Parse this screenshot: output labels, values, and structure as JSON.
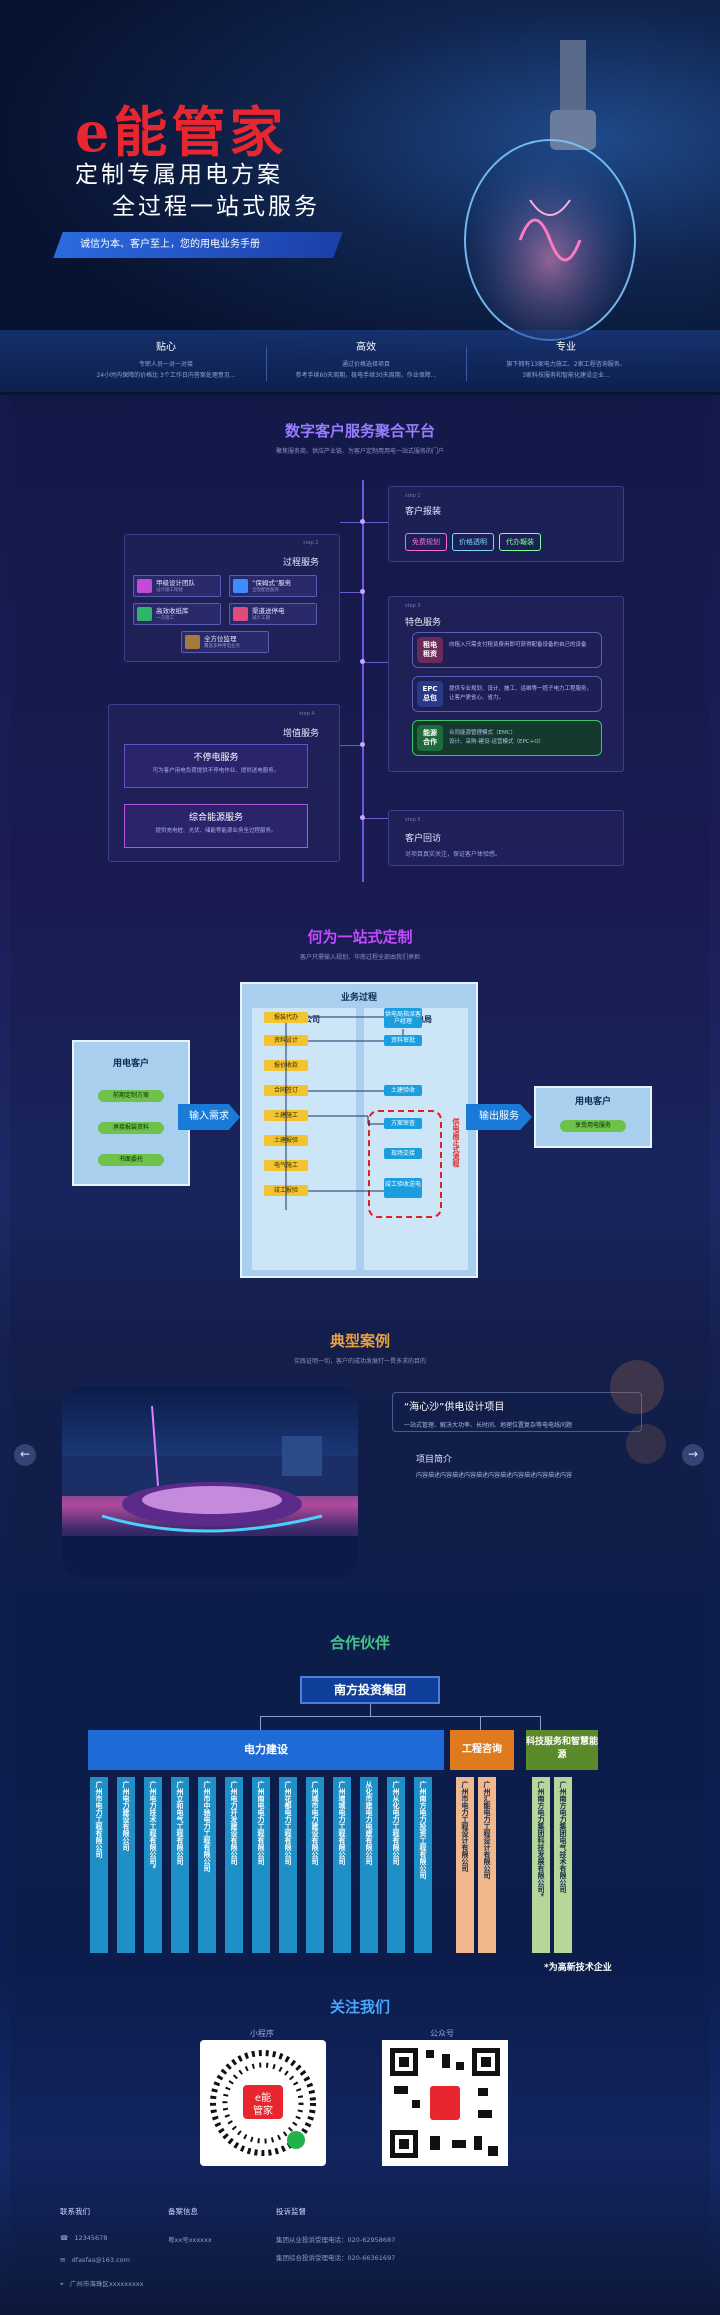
{
  "hero": {
    "logo": "e能管家",
    "line1": "定制专属用电方案",
    "line2": "全过程一站式服务",
    "bar": "诚信为本、客户至上，您的用电业务手册",
    "features": [
      {
        "title": "贴心",
        "desc1": "专职人员一对一对接",
        "desc2": "24小时内保障的价格比 3个工作日内答案处理意见..."
      },
      {
        "title": "高效",
        "desc1": "通过价格选择项目",
        "desc2": "参考手续60天周期，极电手续30天周期，作业保障..."
      },
      {
        "title": "专业",
        "desc1": "旗下拥有13家电力施工、2家工程咨询服务、",
        "desc2": "3家科技服务和智能化建设企业..."
      }
    ]
  },
  "platform": {
    "title": "数字客户服务聚合平台",
    "subtitle": "聚焦服务商、供应产业链、为客户定制用用电一站式服务的门户",
    "report": {
      "step": "step 1",
      "title": "客户报装",
      "pills": [
        "免费规划",
        "价格透明",
        "代办報装"
      ]
    },
    "process": {
      "step": "step 2",
      "title": "过程服务",
      "items": [
        {
          "t": "甲级设计团队",
          "s": "设计施工衔接"
        },
        {
          "t": "“保姆式”服务",
          "s": "全程配合服务"
        },
        {
          "t": "高效收纸库",
          "s": "一次施工"
        },
        {
          "t": "渠道送停电",
          "s": "减少工期"
        },
        {
          "t": "全方位监理",
          "s": "覆盖多种用电业务"
        }
      ]
    },
    "featured": {
      "step": "step 3",
      "title": "特色服务",
      "items": [
        {
          "t": "租电\n租资",
          "d": "向租入只需支付租赁费用即可获得配备设备的自己的设备"
        },
        {
          "t": "EPC\n总包",
          "d": "提供专业规划、设计、施工、运维等一揽子电力工程服务，让客户更省心、省力。"
        },
        {
          "t": "能源\n合作",
          "d": "合同能源管理模式（EMC）\n设计、采购-建设-运营模式（EPC+O）"
        }
      ]
    },
    "value": {
      "step": "step 4",
      "title": "增值服务",
      "items": [
        {
          "t": "不停电服务",
          "d": "可为客户用电负荷提供不停电作业、提供送电服务。"
        },
        {
          "t": "综合能源服务",
          "d": "提供充电桩、光伏、储能等能源业务全过程服务。"
        }
      ]
    },
    "followup": {
      "step": "step 5",
      "title": "客户回访",
      "desc": "对项目真实关注，保证客户体验感。"
    }
  },
  "onestop": {
    "title": "何为一站式定制",
    "subtitle": "客户只需输入规划、华南过程全部由我们承担",
    "frame": "业务过程",
    "company": "业务公司",
    "grid": "区供电局",
    "left_title": "用电客户",
    "left_items": [
      "前期定制方案",
      "承接报装资料",
      "书面委托"
    ],
    "input": "输入需求",
    "output": "输出服务",
    "right_title": "用电客户",
    "right_item": "享受用电服务",
    "yellow": [
      "报装代办",
      "资料设计",
      "报价收款",
      "合同签订",
      "土建施工",
      "土建报验",
      "电气施工",
      "竣工报验"
    ],
    "blue": [
      "供电局指派客户经理",
      "资料审批",
      "土建验收",
      "方案审查",
      "现场交接",
      "竣工验收送电"
    ],
    "red_note": "供电局正式流程"
  },
  "cases": {
    "title": "典型案例",
    "subtitle": "实践证明一切，客户的成功发展打一贯多求的目的",
    "name": "“海心沙”供电设计项目",
    "tag": "一站式管理、解决大功率、长时间、地理位置复杂等电电线问题",
    "intro_title": "项目简介",
    "intro": "内容描述内容描述内容描述内容描述内容描述内容描述内容",
    "prev": "←",
    "next": "→"
  },
  "partners": {
    "title": "合作伙伴",
    "group": "南方投资集团",
    "cat1": "电力建设",
    "cat2": "工程咨询",
    "cat3": "科技服务和智慧能源",
    "c1": [
      "广州市电力工程有限公司",
      "广州电力建设有限公司",
      "广州电力技术工程有限公司*",
      "广州立和电气工程有限公司",
      "广州市中驰电力工程有限公司",
      "广州电力开发建设有限公司",
      "广州南电电力工程有限公司",
      "广州花都电力工程有限公司",
      "广州城市电力建设有限公司",
      "广州增城电力工程有限公司",
      "从化市建电力电建有限公司",
      "广州从化电力工程有限公司",
      "广州南方电力投资工程有限公司"
    ],
    "c2": [
      "广州市电力工程设计有限公司",
      "广州汇能电力工程设计有限公司"
    ],
    "c3": [
      "广州南方电力集团科技发展有限公司*",
      "广州南方电力集团电气技术有限公司"
    ],
    "note": "*为高新技术企业"
  },
  "follow": {
    "title": "关注我们",
    "mini": "小程序",
    "official": "公众号"
  },
  "footer": {
    "contact": "联系我们",
    "phone": "12345678",
    "email": "dfasfas@163.com",
    "address": "广州市海珠区xxxxxxxxx",
    "record": "备案信息",
    "record_no": "粤xx号xxxxxx",
    "complaint": "投诉监督",
    "c1": "集团从业投诉受理电话：020-62958687",
    "c2": "集团综合投诉受理电话：020-66361697"
  },
  "colors": {
    "accent": "#2a6be0",
    "brand_red": "#e8262f",
    "title_purple": "#9b7bff"
  }
}
